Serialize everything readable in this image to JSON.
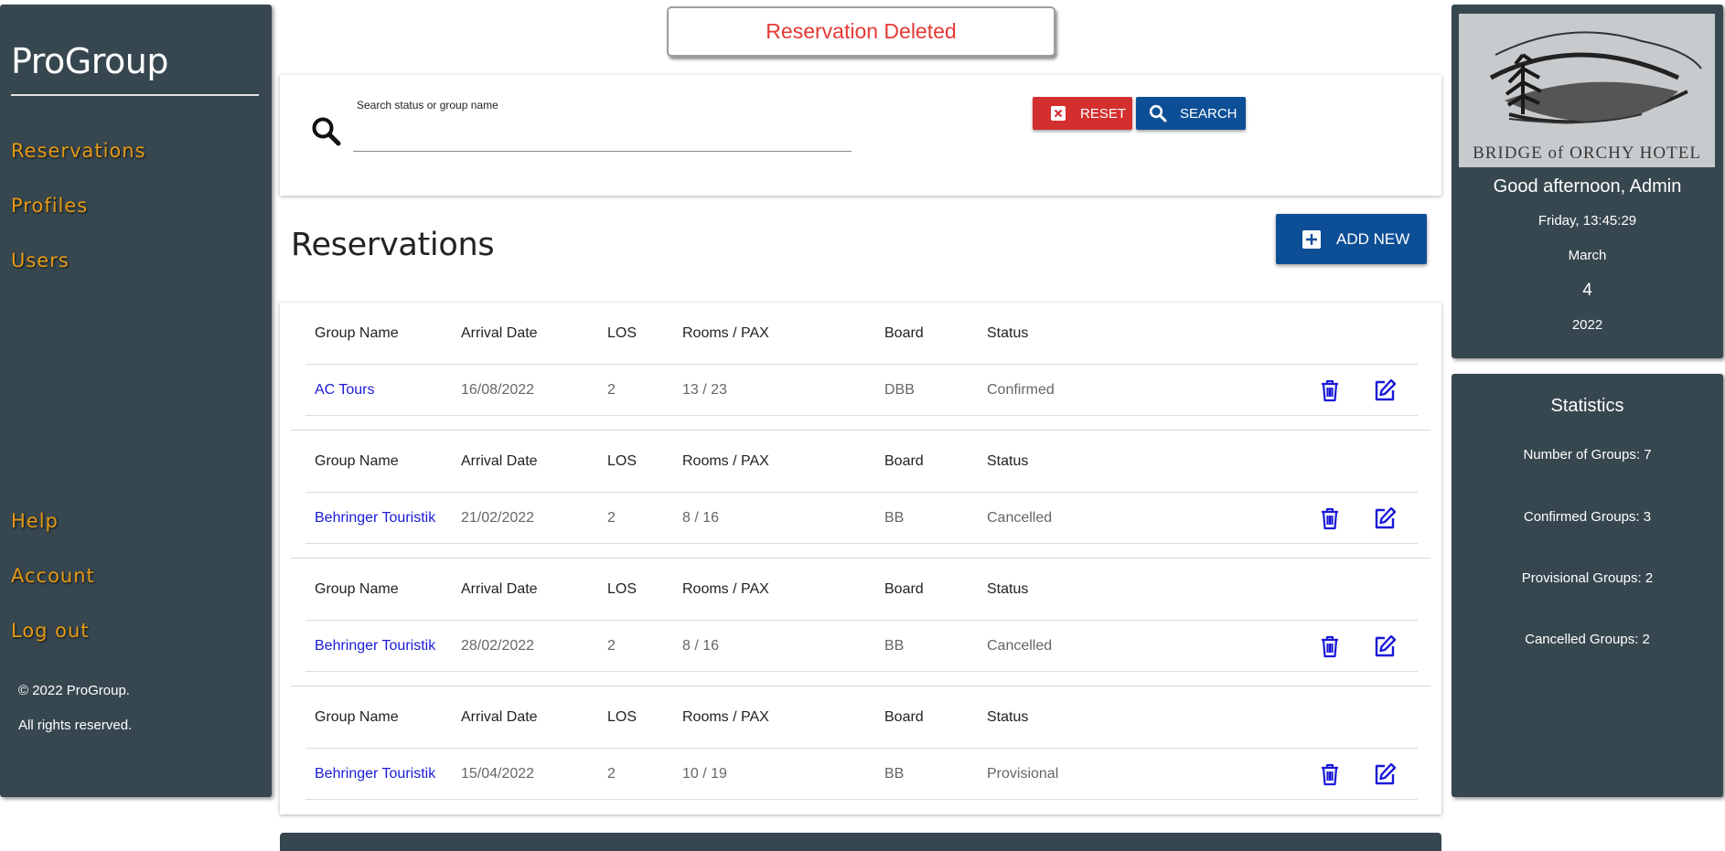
{
  "app": {
    "brand": "ProGroup",
    "nav": [
      "Reservations",
      "Profiles",
      "Users"
    ],
    "nav_bottom": [
      "Help",
      "Account",
      "Log out"
    ],
    "copyright": "© 2022 ProGroup.",
    "rights": "All rights reserved."
  },
  "toast": {
    "message": "Reservation Deleted"
  },
  "search": {
    "label": "Search status or group name",
    "value": "",
    "reset_label": "RESET",
    "search_label": "SEARCH"
  },
  "page": {
    "title": "Reservations",
    "add_label": "ADD NEW"
  },
  "table": {
    "headers": [
      "Group Name",
      "Arrival Date",
      "LOS",
      "Rooms / PAX",
      "Board",
      "Status"
    ],
    "rows": [
      {
        "group": "AC Tours",
        "arrival": "16/08/2022",
        "los": "2",
        "rooms_pax": "13 / 23",
        "board": "DBB",
        "status": "Confirmed"
      },
      {
        "group": "Behringer Touristik",
        "arrival": "21/02/2022",
        "los": "2",
        "rooms_pax": "8 / 16",
        "board": "BB",
        "status": "Cancelled"
      },
      {
        "group": "Behringer Touristik",
        "arrival": "28/02/2022",
        "los": "2",
        "rooms_pax": "8 / 16",
        "board": "BB",
        "status": "Cancelled"
      },
      {
        "group": "Behringer Touristik",
        "arrival": "15/04/2022",
        "los": "2",
        "rooms_pax": "10 / 19",
        "board": "BB",
        "status": "Provisional"
      }
    ]
  },
  "greeting": {
    "logo_text": "BRIDGE of ORCHY HOTEL",
    "message": "Good afternoon, Admin",
    "time": "Friday, 13:45:29",
    "month": "March",
    "day": "4",
    "year": "2022"
  },
  "stats": {
    "title": "Statistics",
    "items": [
      "Number of Groups: 7",
      "Confirmed Groups: 3",
      "Provisional Groups: 2",
      "Cancelled Groups: 2"
    ]
  },
  "colors": {
    "panel": "#37474f",
    "nav_text": "#e59a16",
    "reset": "#d32f2f",
    "primary": "#0d4f96",
    "link": "#1a1ad8",
    "toast_text": "#e53935"
  }
}
